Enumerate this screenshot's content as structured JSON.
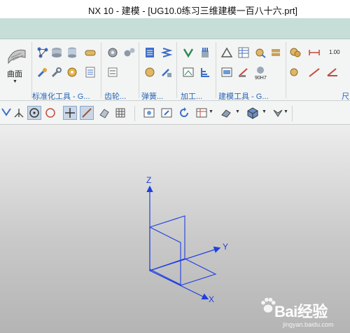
{
  "window": {
    "title": "NX 10 - 建模 - [UG10.0练习三维建模一百八十六.prt]"
  },
  "ribbon": {
    "surface_label": "曲面",
    "groups": [
      {
        "label": "标准化工具 - G..."
      },
      {
        "label": "齿轮..."
      },
      {
        "label": "弹簧..."
      },
      {
        "label": "加工..."
      },
      {
        "label": "建模工具 - G..."
      },
      {
        "label": "尺"
      }
    ],
    "number_field": "1.00",
    "icon_caption": "90H7"
  },
  "viewport": {
    "axes": {
      "z": "Z",
      "y": "Y",
      "x": "X"
    },
    "axis_color": "#1f3fe0"
  },
  "watermark": {
    "text": "Bai经验",
    "sub": "jingyan.baidu.com"
  }
}
